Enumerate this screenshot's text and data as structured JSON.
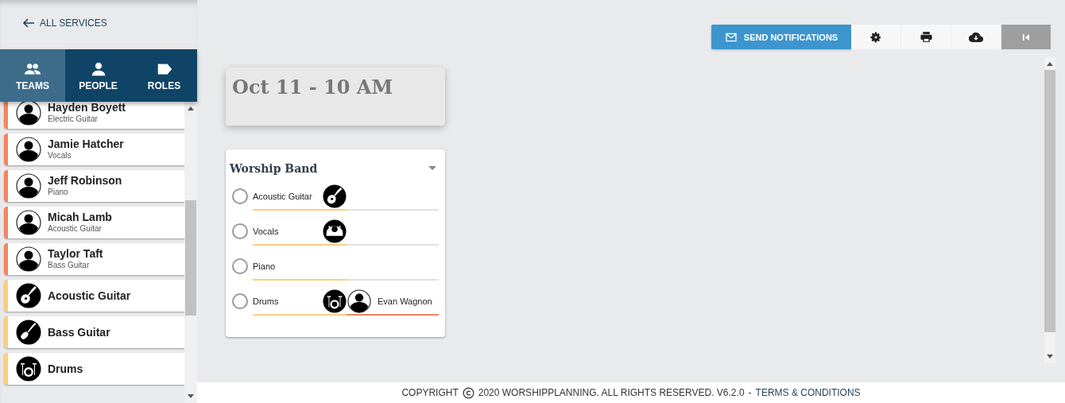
{
  "back_link": {
    "label": "ALL SERVICES"
  },
  "tabs": [
    {
      "label": "TEAMS",
      "selected": true
    },
    {
      "label": "PEOPLE",
      "selected": false
    },
    {
      "label": "ROLES",
      "selected": false
    }
  ],
  "sidebar": {
    "items": [
      {
        "kind": "person",
        "name": "Hayden Boyett",
        "role": "Electric Guitar",
        "color": "#f4845f"
      },
      {
        "kind": "person",
        "name": "Jamie Hatcher",
        "role": "Vocals",
        "color": "#f4845f"
      },
      {
        "kind": "person",
        "name": "Jeff Robinson",
        "role": "Piano",
        "color": "#f4845f"
      },
      {
        "kind": "person",
        "name": "Micah Lamb",
        "role": "Acoustic Guitar",
        "color": "#f4845f"
      },
      {
        "kind": "person",
        "name": "Taylor Taft",
        "role": "Bass Guitar",
        "color": "#f4845f"
      },
      {
        "kind": "guitar",
        "name": "Acoustic Guitar",
        "color": "#ffcc80"
      },
      {
        "kind": "bass",
        "name": "Bass Guitar",
        "color": "#ffcc80"
      },
      {
        "kind": "drums",
        "name": "Drums",
        "color": "#ffcc80"
      }
    ]
  },
  "toolbar": {
    "send_button": "SEND NOTIFICATIONS"
  },
  "service": {
    "title": "Oct 11 - 10 AM"
  },
  "team": {
    "name": "Worship Band",
    "slots": [
      {
        "kind": "guitar",
        "role": "Acoustic Guitar",
        "selected": false
      },
      {
        "kind": "vocals",
        "role": "Vocals",
        "selected": false
      },
      {
        "kind": "plain",
        "role": "Piano",
        "selected": false
      },
      {
        "kind": "drums",
        "role": "Drums",
        "selected": false,
        "person": "Evan Wagnon"
      }
    ]
  },
  "footer": {
    "copyright": "COPYRIGHT",
    "text": "2020 WORSHIPPLANNING. ALL RIGHTS RESERVED. V6.2.0",
    "separator": "-",
    "link": "TERMS & CONDITIONS"
  }
}
